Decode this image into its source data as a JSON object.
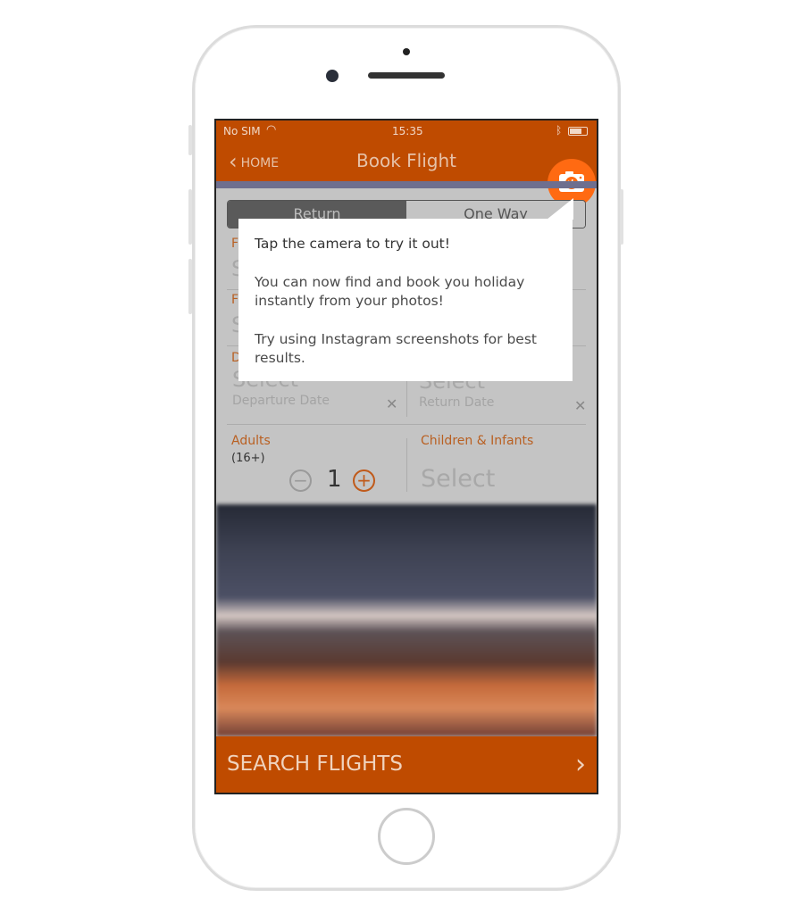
{
  "status_bar": {
    "carrier": "No SIM",
    "time": "15:35"
  },
  "nav": {
    "back_label": "HOME",
    "title": "Book Flight"
  },
  "trip_type": {
    "options": [
      "Return",
      "One Way"
    ],
    "selected": "Return"
  },
  "form": {
    "row1_label_partial": "F",
    "row1_value_partial": "S",
    "row2_label_partial": "F",
    "row2_value_partial": "S",
    "date_label_partial": "D",
    "departure": {
      "value": "Select",
      "caption": "Departure Date"
    },
    "return": {
      "value": "Select",
      "caption": "Return Date"
    },
    "adults": {
      "label": "Adults",
      "note": "(16+)",
      "count": "1"
    },
    "children": {
      "label": "Children & Infants",
      "value": "Select"
    }
  },
  "tooltip": {
    "line1": "Tap the camera to try it out!",
    "line2": "You can now find and book you holiday instantly from your photos!",
    "line3": "Try using Instagram screenshots for best results."
  },
  "search_button": {
    "label": "SEARCH FLIGHTS"
  },
  "colors": {
    "brand": "#bf4b00",
    "camera_highlight": "#ff6a12"
  }
}
